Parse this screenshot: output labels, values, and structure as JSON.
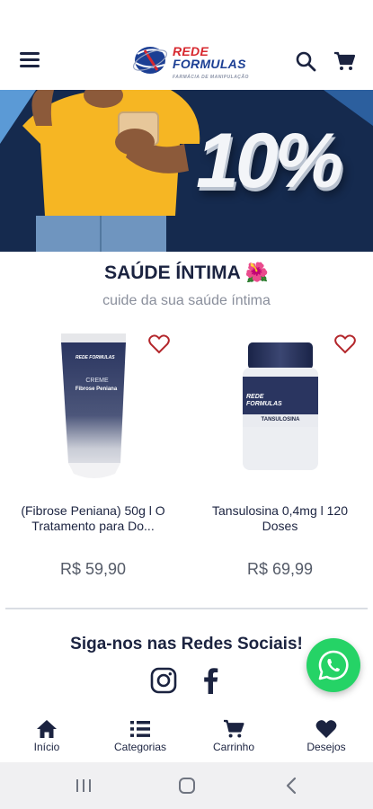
{
  "header": {
    "brand_line1": "REDE",
    "brand_line2": "FORMULAS",
    "brand_tagline": "FARMÁCIA DE MANIPULAÇÃO"
  },
  "banner": {
    "promo_text": "10%"
  },
  "section": {
    "title": "SAÚDE ÍNTIMA 🌺",
    "subtitle": "cuide da sua saúde íntima"
  },
  "products": [
    {
      "package_brand": "REDE FORMULAS",
      "package_type": "CREME",
      "package_label": "Fibrose Peniana",
      "name": "(Fibrose Peniana)  50g l O Tratamento para Do...",
      "price": "R$ 59,90"
    },
    {
      "package_brand": "REDE FORMULAS",
      "package_label": "TANSULOSINA",
      "name": "Tansulosina 0,4mg l 120 Doses",
      "price": "R$ 69,99"
    }
  ],
  "social": {
    "title": "Siga-nos nas Redes Sociais!"
  },
  "bottom_nav": [
    {
      "label": "Início",
      "icon": "home-icon"
    },
    {
      "label": "Categorias",
      "icon": "list-icon"
    },
    {
      "label": "Carrinho",
      "icon": "cart-icon"
    },
    {
      "label": "Desejos",
      "icon": "heart-icon"
    }
  ],
  "colors": {
    "brand_navy": "#1b2340",
    "brand_red": "#d7282f",
    "brand_blue": "#1c3f94",
    "whatsapp_green": "#25d366",
    "banner_navy": "#152a4e",
    "banner_yellow": "#f6b623"
  }
}
